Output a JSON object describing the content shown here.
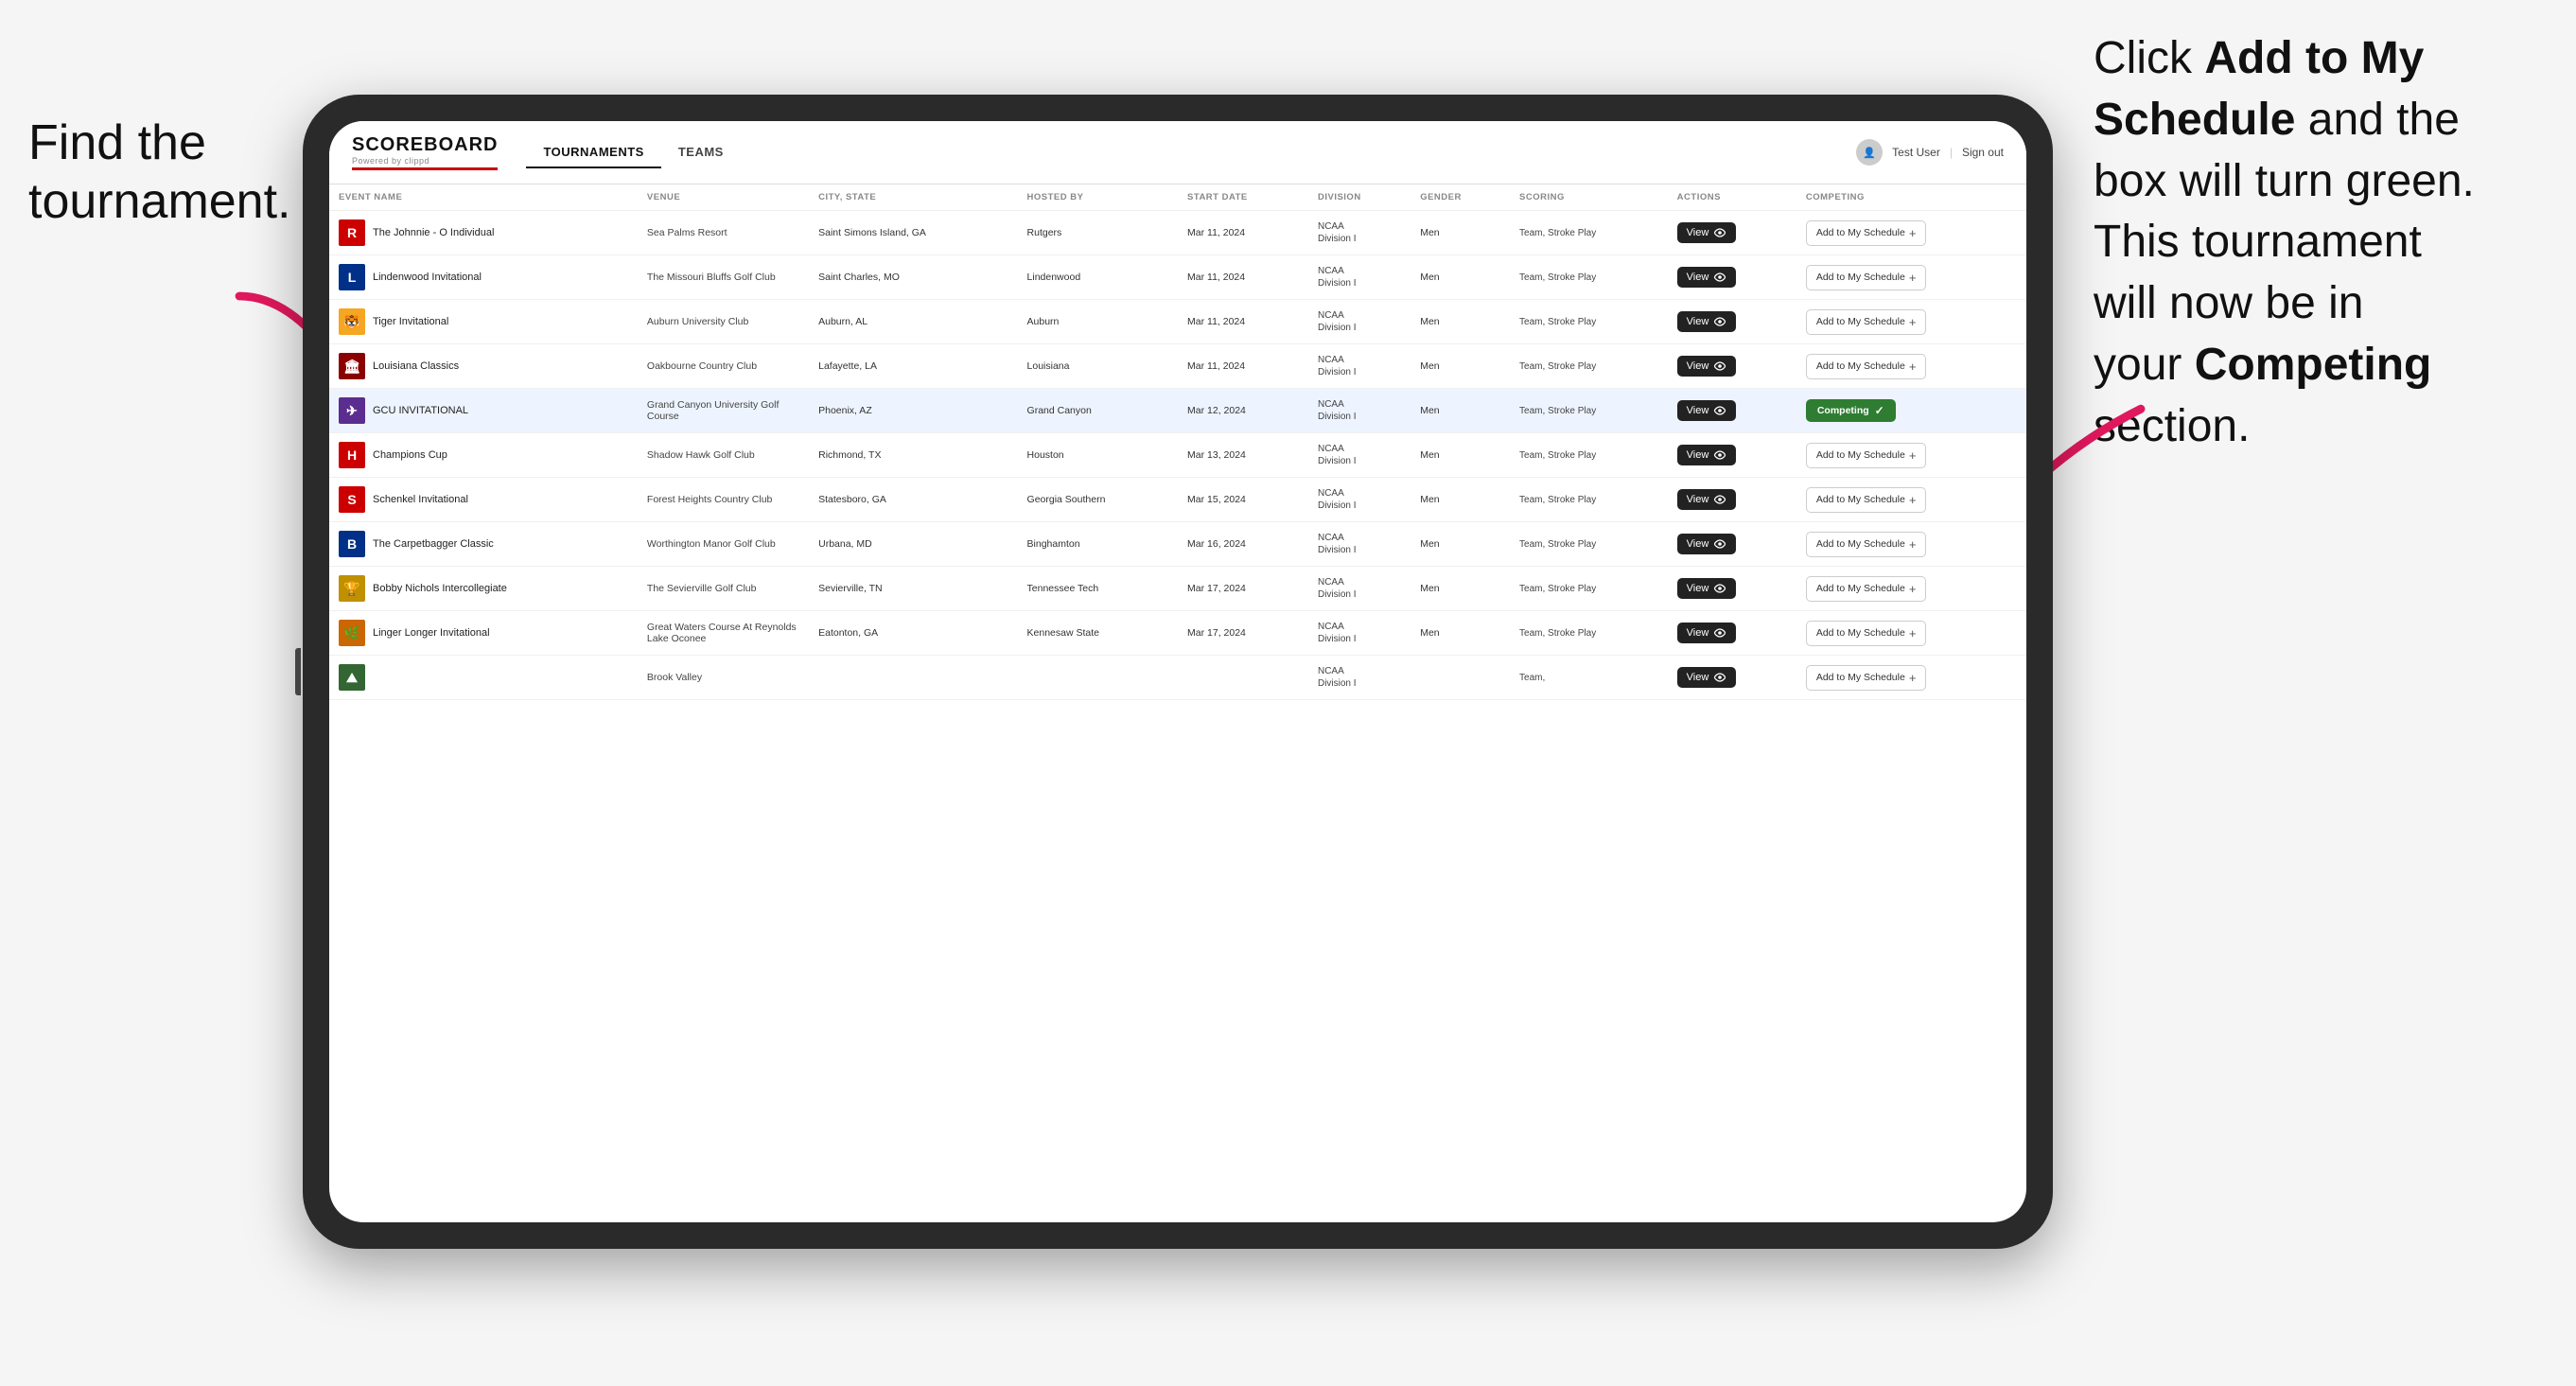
{
  "annotations": {
    "left": "Find the\ntournament.",
    "right_line1": "Click ",
    "right_bold1": "Add to My\nSchedule",
    "right_line2": " and the\nbox will turn green.\nThis tournament\nwill now be in\nyour ",
    "right_bold2": "Competing",
    "right_line3": "\nsection."
  },
  "app": {
    "logo": "SCOREBOARD",
    "logo_sub": "Powered by clippd",
    "nav_tabs": [
      "TOURNAMENTS",
      "TEAMS"
    ],
    "active_tab": "TOURNAMENTS",
    "user_label": "Test User",
    "sign_out": "Sign out"
  },
  "table": {
    "columns": [
      "EVENT NAME",
      "VENUE",
      "CITY, STATE",
      "HOSTED BY",
      "START DATE",
      "DIVISION",
      "GENDER",
      "SCORING",
      "ACTIONS",
      "COMPETING"
    ],
    "rows": [
      {
        "logo_text": "R",
        "logo_color": "#cc0000",
        "event": "The Johnnie - O Individual",
        "venue": "Sea Palms Resort",
        "city_state": "Saint Simons Island, GA",
        "hosted_by": "Rutgers",
        "start_date": "Mar 11, 2024",
        "division": "NCAA Division I",
        "gender": "Men",
        "scoring": "Team, Stroke Play",
        "competing": "add"
      },
      {
        "logo_text": "L",
        "logo_color": "#003087",
        "event": "Lindenwood Invitational",
        "venue": "The Missouri Bluffs Golf Club",
        "city_state": "Saint Charles, MO",
        "hosted_by": "Lindenwood",
        "start_date": "Mar 11, 2024",
        "division": "NCAA Division I",
        "gender": "Men",
        "scoring": "Team, Stroke Play",
        "competing": "add"
      },
      {
        "logo_text": "🐯",
        "logo_color": "#f5a623",
        "event": "Tiger Invitational",
        "venue": "Auburn University Club",
        "city_state": "Auburn, AL",
        "hosted_by": "Auburn",
        "start_date": "Mar 11, 2024",
        "division": "NCAA Division I",
        "gender": "Men",
        "scoring": "Team, Stroke Play",
        "competing": "add"
      },
      {
        "logo_text": "🏴",
        "logo_color": "#8B0000",
        "event": "Louisiana Classics",
        "venue": "Oakbourne Country Club",
        "city_state": "Lafayette, LA",
        "hosted_by": "Louisiana",
        "start_date": "Mar 11, 2024",
        "division": "NCAA Division I",
        "gender": "Men",
        "scoring": "Team, Stroke Play",
        "competing": "add"
      },
      {
        "logo_text": "✈",
        "logo_color": "#5c2d91",
        "event": "GCU INVITATIONAL",
        "venue": "Grand Canyon University Golf Course",
        "city_state": "Phoenix, AZ",
        "hosted_by": "Grand Canyon",
        "start_date": "Mar 12, 2024",
        "division": "NCAA Division I",
        "gender": "Men",
        "scoring": "Team, Stroke Play",
        "competing": "competing",
        "highlighted": true
      },
      {
        "logo_text": "H",
        "logo_color": "#cc0000",
        "event": "Champions Cup",
        "venue": "Shadow Hawk Golf Club",
        "city_state": "Richmond, TX",
        "hosted_by": "Houston",
        "start_date": "Mar 13, 2024",
        "division": "NCAA Division I",
        "gender": "Men",
        "scoring": "Team, Stroke Play",
        "competing": "add"
      },
      {
        "logo_text": "S",
        "logo_color": "#cc0000",
        "event": "Schenkel Invitational",
        "venue": "Forest Heights Country Club",
        "city_state": "Statesboro, GA",
        "hosted_by": "Georgia Southern",
        "start_date": "Mar 15, 2024",
        "division": "NCAA Division I",
        "gender": "Men",
        "scoring": "Team, Stroke Play",
        "competing": "add"
      },
      {
        "logo_text": "B",
        "logo_color": "#003087",
        "event": "The Carpetbagger Classic",
        "venue": "Worthington Manor Golf Club",
        "city_state": "Urbana, MD",
        "hosted_by": "Binghamton",
        "start_date": "Mar 16, 2024",
        "division": "NCAA Division I",
        "gender": "Men",
        "scoring": "Team, Stroke Play",
        "competing": "add"
      },
      {
        "logo_text": "🔱",
        "logo_color": "#c09000",
        "event": "Bobby Nichols Intercollegiate",
        "venue": "The Sevierville Golf Club",
        "city_state": "Sevierville, TN",
        "hosted_by": "Tennessee Tech",
        "start_date": "Mar 17, 2024",
        "division": "NCAA Division I",
        "gender": "Men",
        "scoring": "Team, Stroke Play",
        "competing": "add"
      },
      {
        "logo_text": "🌊",
        "logo_color": "#cc6600",
        "event": "Linger Longer Invitational",
        "venue": "Great Waters Course At Reynolds Lake Oconee",
        "city_state": "Eatonton, GA",
        "hosted_by": "Kennesaw State",
        "start_date": "Mar 17, 2024",
        "division": "NCAA Division I",
        "gender": "Men",
        "scoring": "Team, Stroke Play",
        "competing": "add"
      },
      {
        "logo_text": "🏔",
        "logo_color": "#336633",
        "event": "",
        "venue": "Brook Valley",
        "city_state": "",
        "hosted_by": "",
        "start_date": "",
        "division": "NCAA",
        "gender": "",
        "scoring": "Team,",
        "competing": "add"
      }
    ],
    "buttons": {
      "view": "View",
      "add_to_schedule": "Add to My Schedule",
      "competing": "Competing"
    }
  }
}
